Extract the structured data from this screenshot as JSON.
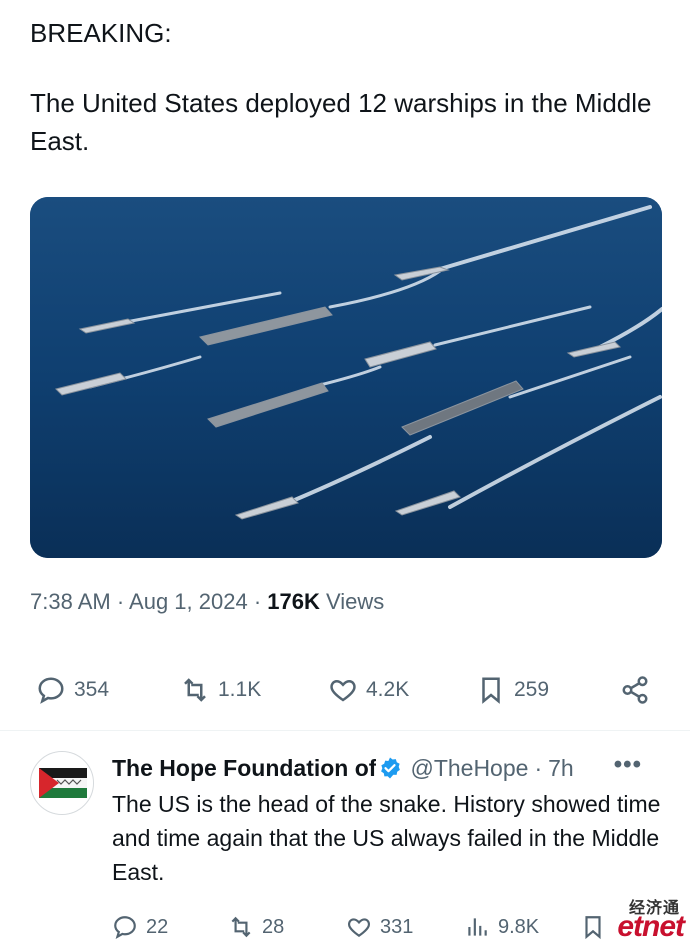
{
  "tweet": {
    "label": "BREAKING:",
    "body": "The United States deployed 12 warships in the Middle East.",
    "media_alt": "Aerial photo of naval fleet sailing in formation",
    "timestamp": "7:38 AM · Aug 1, 2024 ·",
    "views_count": "176K",
    "views_label": "Views",
    "replies": "354",
    "reposts": "1.1K",
    "likes": "4.2K",
    "bookmarks": "259"
  },
  "reply": {
    "author_name": "The Hope Foundation of",
    "handle": "@TheHope",
    "separator": "·",
    "time": "7h",
    "more": "•••",
    "text": "The US is the head of the snake. History showed time and time again that the US always failed in the Middle East.",
    "replies": "22",
    "reposts": "28",
    "likes": "331",
    "views": "9.8K"
  },
  "watermark": {
    "top": "经济通",
    "logo": "etnet"
  },
  "colors": {
    "text": "#0f1419",
    "secondary": "#536471",
    "verified": "#1d9bf0",
    "divider": "#eff3f4"
  },
  "icons": {
    "reply": "reply-icon",
    "repost": "repost-icon",
    "like": "heart-icon",
    "bookmark": "bookmark-icon",
    "share": "share-icon",
    "views": "analytics-icon",
    "verified": "verified-badge-icon",
    "more": "more-icon"
  }
}
